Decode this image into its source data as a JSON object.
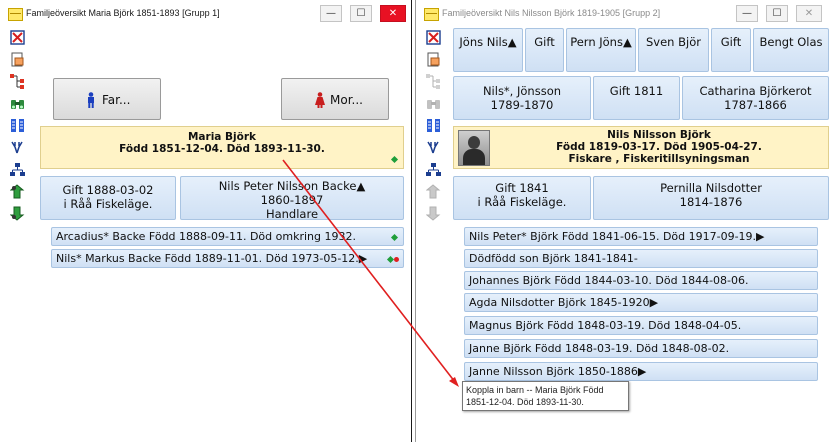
{
  "window1": {
    "title": "Familjeöversikt Maria Björk 1851-1893 [Grupp 1]",
    "controls": {
      "minimize": "—",
      "maximize": "☐",
      "close": "✕"
    },
    "father_button": "Far...",
    "mother_button": "Mor...",
    "person": {
      "name": "Maria Björk",
      "line2": "Född 1851-12-04. Död 1893-11-30."
    },
    "marriage": {
      "line1": "Gift 1888-03-02",
      "line2": "i  Råå Fiskeläge."
    },
    "spouse": {
      "line1": "Nils Peter Nilsson Backe▲",
      "line2": "1860-1897",
      "line3": "Handlare"
    },
    "children": [
      "Arcadius* Backe Född 1888-09-11. Död omkring 1932.",
      "Nils* Markus Backe Född 1889-11-01. Död 1973-05-12.▶"
    ]
  },
  "window2": {
    "title": "Familjeöversikt Nils Nilsson Björk 1819-1905 [Grupp 2]",
    "controls": {
      "minimize": "—",
      "maximize": "☐",
      "close": "✕"
    },
    "grandparents": [
      "Jöns Nils▲",
      "Gift",
      "Pern Jöns▲",
      "Sven Björ",
      "Gift",
      "Bengt Olas"
    ],
    "father": {
      "line1": "Nils*, Jönsson",
      "line2": "1789-1870"
    },
    "parents_marriage": "Gift 1811",
    "mother": {
      "line1": "Catharina Björkerot",
      "line2": "1787-1866"
    },
    "person": {
      "name": "Nils Nilsson Björk",
      "line2": "Född 1819-03-17. Död 1905-04-27.",
      "line3": "Fiskare , Fiskeritillsyningsman"
    },
    "marriage": {
      "line1": "Gift 1841",
      "line2": "i  Råå Fiskeläge."
    },
    "spouse": {
      "line1": "Pernilla Nilsdotter",
      "line2": "1814-1876"
    },
    "children": [
      "Nils Peter* Björk Född 1841-06-15. Död 1917-09-19.▶",
      "Dödfödd son Björk 1841-1841-",
      "Johannes Björk Född 1844-03-10. Död 1844-08-06.",
      "Agda Nilsdotter Björk 1845-1920▶",
      "Magnus Björk Född 1848-03-19. Död 1848-04-05.",
      "Janne Björk Född 1848-03-19. Död 1848-08-02.",
      "Janne Nilsson Björk 1850-1886▶"
    ]
  },
  "tooltip": {
    "line1": "Koppla in barn -- Maria Björk  Född",
    "line2": "1851-12-04. Död 1893-11-30."
  },
  "colors": {
    "accent_button": "#cfe0f4",
    "selected_person": "#fff3c6",
    "close_button": "#e81123",
    "drag_arrow": "#e02020",
    "green_marker": "#1f9e3a"
  }
}
